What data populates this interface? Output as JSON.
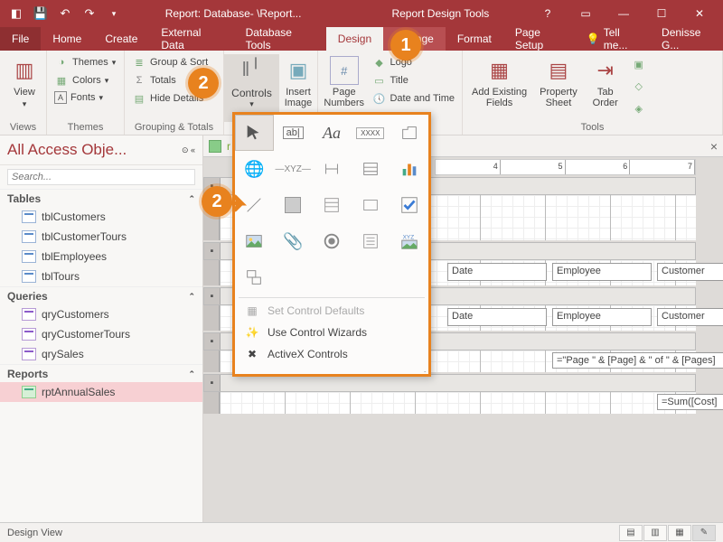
{
  "titlebar": {
    "doc_title": "Report: Database- \\Report...",
    "tools_title": "Report Design Tools"
  },
  "tabs": {
    "file": "File",
    "home": "Home",
    "create": "Create",
    "external": "External Data",
    "dbtools": "Database Tools",
    "design": "Design",
    "arrange": "Arrange",
    "format": "Format",
    "pagesetup": "Page Setup"
  },
  "tell_me": "Tell me...",
  "user": "Denisse G...",
  "ribbon": {
    "views": {
      "label": "View",
      "group": "Views"
    },
    "themes": {
      "themes": "Themes",
      "colors": "Colors",
      "fonts": "Fonts",
      "group": "Themes"
    },
    "grouping": {
      "groupsort": "Group & Sort",
      "totals": "Totals",
      "hide": "Hide Details",
      "group": "Grouping & Totals"
    },
    "controls": {
      "label": "Controls"
    },
    "insert_image": "Insert\nImage",
    "page_numbers": "Page\nNumbers",
    "headerfooter": {
      "logo": "Logo",
      "title": "Title",
      "datetime": "Date and Time"
    },
    "tools": {
      "addfields": "Add Existing\nFields",
      "propsheet": "Property\nSheet",
      "taborder": "Tab\nOrder",
      "group": "Tools"
    }
  },
  "nav": {
    "header": "All Access Obje...",
    "search_placeholder": "Search...",
    "sections": {
      "tables": "Tables",
      "queries": "Queries",
      "reports": "Reports"
    },
    "tables": [
      "tblCustomers",
      "tblCustomerTours",
      "tblEmployees",
      "tblTours"
    ],
    "queries": [
      "qryCustomers",
      "qryCustomerTours",
      "qrySales"
    ],
    "reports": [
      "rptAnnualSales"
    ]
  },
  "doc_tab": "r",
  "design_sections": {
    "pagehdr": "",
    "detail": "",
    "pagefoot": "",
    "reportfoot": ""
  },
  "fields": {
    "date1": "Date",
    "emp1": "Employee",
    "cust1": "Customer",
    "date2": "Date",
    "emp2": "Employee",
    "cust2": "Customer",
    "pageexpr": "=\"Page \" & [Page] & \" of \" & [Pages]",
    "sumexpr": "=Sum([Cost]"
  },
  "dropdown": {
    "set_defaults": "Set Control Defaults",
    "wizards": "Use Control Wizards",
    "activex": "ActiveX Controls"
  },
  "callouts": {
    "c1": "1",
    "c2a": "2",
    "c2b": "2"
  },
  "status": {
    "mode": "Design View"
  }
}
